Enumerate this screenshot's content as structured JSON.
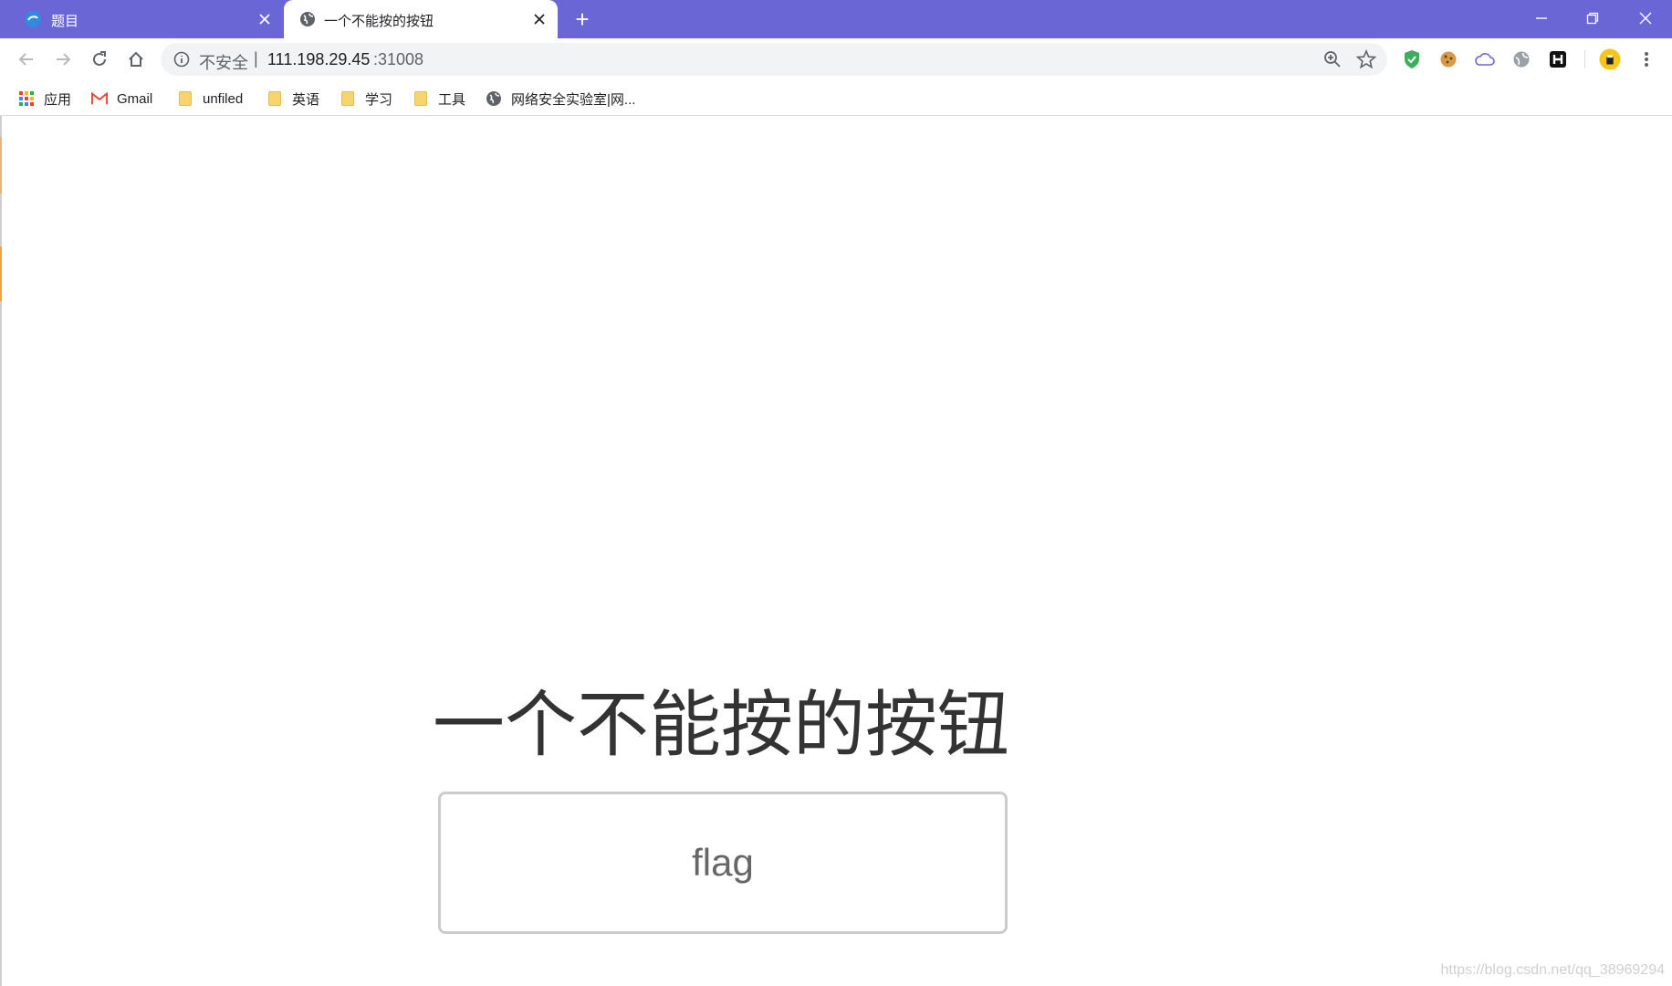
{
  "browser": {
    "tabs": [
      {
        "title": "题目",
        "active": false
      },
      {
        "title": "一个不能按的按钮",
        "active": true
      }
    ],
    "new_tab_symbol": "+",
    "address": {
      "security_label": "不安全",
      "separator": "|",
      "host": "111.198.29.45",
      "port": ":31008"
    },
    "colors": {
      "tabstrip": "#6b66d6"
    },
    "bookmarks": [
      {
        "label": "应用",
        "icon": "apps-grid-icon"
      },
      {
        "label": "Gmail",
        "icon": "gmail-icon"
      },
      {
        "label": "unfiled",
        "icon": "folder-icon"
      },
      {
        "label": "英语",
        "icon": "folder-icon"
      },
      {
        "label": "学习",
        "icon": "folder-icon"
      },
      {
        "label": "工具",
        "icon": "folder-icon"
      },
      {
        "label": "网络安全实验室|网...",
        "icon": "globe-icon"
      }
    ]
  },
  "page": {
    "heading": "一个不能按的按钮",
    "button_label": "flag"
  },
  "watermark": "https://blog.csdn.net/qq_38969294"
}
